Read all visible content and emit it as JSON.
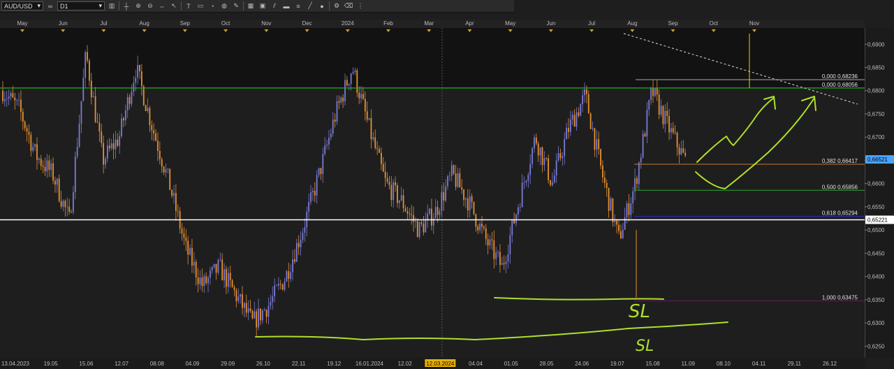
{
  "toolbar": {
    "symbol": "AUD/USD",
    "timeframe": "D1",
    "icons": [
      "link-icon",
      "chart-type-icon",
      "crosshair-icon",
      "zoom-in-icon",
      "zoom-out-icon",
      "scroll-icon",
      "cursor-icon",
      "text-icon",
      "note-icon",
      "bell-icon",
      "globe-icon",
      "pencil-icon",
      "grid-icon",
      "image-icon",
      "channel-icon",
      "ruler-icon",
      "fibonacci-icon",
      "line-tool-icon",
      "circle-tool-icon",
      "settings-icon",
      "eraser-icon",
      "more-icon"
    ]
  },
  "colors": {
    "bull": "#7b7bd8",
    "bear": "#e8912e",
    "green_line": "#22aa22",
    "white_line": "#ffffff",
    "annotation": "#aee02a",
    "fib_382": "#c77a30",
    "fib_500": "#2aa62a",
    "fib_618": "#2a2acc",
    "fib_1000": "#6a1a6a"
  },
  "chart_data": {
    "type": "candlestick",
    "symbol": "AUD/USD",
    "timeframe": "D1",
    "ylim": [
      0.6225,
      0.6935
    ],
    "y_ticks": [
      "0,6900",
      "0,6850",
      "0,6800",
      "0,6750",
      "0,6700",
      "0,6650",
      "0,6600",
      "0,6550",
      "0,6500",
      "0,6450",
      "0,6400",
      "0,6350",
      "0,6300",
      "0,6250"
    ],
    "top_months": [
      "May",
      "Jun",
      "Jul",
      "Aug",
      "Sep",
      "Oct",
      "Nov",
      "Dec",
      "2024",
      "Feb",
      "Mar",
      "Apr",
      "May",
      "Jun",
      "Jul",
      "Aug",
      "Sep",
      "Oct",
      "Nov"
    ],
    "bottom_dates": [
      "13.04.2023",
      "19.05",
      "15.06",
      "12.07",
      "08.08",
      "04.09",
      "29.09",
      "26.10",
      "22.11",
      "19.12",
      "16.01.2024",
      "12.02",
      "12.03.2024",
      "04.04",
      "01.05",
      "28.05",
      "24.06",
      "19.07",
      "15.08",
      "11.09",
      "08.10",
      "04.11",
      "29.11",
      "26.12"
    ],
    "highlighted_date": "12.03.2024",
    "price_anchors": [
      0.68,
      0.676,
      0.666,
      0.662,
      0.652,
      0.688,
      0.665,
      0.67,
      0.685,
      0.672,
      0.66,
      0.646,
      0.638,
      0.642,
      0.636,
      0.63,
      0.634,
      0.64,
      0.65,
      0.662,
      0.675,
      0.685,
      0.672,
      0.66,
      0.656,
      0.65,
      0.654,
      0.662,
      0.656,
      0.648,
      0.642,
      0.656,
      0.67,
      0.66,
      0.672,
      0.679,
      0.662,
      0.648,
      0.66,
      0.68,
      0.672,
      0.665
    ],
    "levels": [
      {
        "name": "resistance",
        "value": 0.6806,
        "color": "#22aa22"
      },
      {
        "name": "support",
        "value": 0.65221,
        "color": "#ffffff"
      }
    ],
    "current_price": "0,66521",
    "support_price_label": "0,65221",
    "fibonacci": [
      {
        "label": "0,000 0,68236",
        "value": 0.68236
      },
      {
        "label": "0,000 0,68056",
        "value": 0.68056
      },
      {
        "label": "0,382 0,66417",
        "value": 0.66417
      },
      {
        "label": "0,500 0,65856",
        "value": 0.65856
      },
      {
        "label": "0,618 0,65294",
        "value": 0.65294
      },
      {
        "label": "1,000 0,63475",
        "value": 0.63475
      }
    ],
    "annotations": [
      "SL",
      "SL"
    ]
  }
}
